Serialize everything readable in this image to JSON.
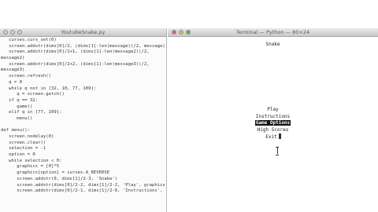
{
  "editor": {
    "title": "YoutubeSnake.py",
    "lines": [
      "   curses.curs_set(0)",
      "   screen.addstr(dims[0]/2, (dims[1]-len(message))/2, message)",
      "   screen.addstr(dims[0]/2+1, (dims[1]-len(message2))/2,",
      "message2)",
      "   screen.addstr(dims[0]/2+2, (dims[1]-len(message3))/2,",
      "message3)",
      "   screen.refresh()",
      "   q = 0",
      "   while q not in [32, 10, 77, 109]:",
      "      q = screen.getch()",
      "   if q == 32:",
      "      game()",
      "   elif q in [77, 109]:",
      "      menu()",
      "",
      "def menu():",
      "   screen.nodelay(0)",
      "   screen.clear()",
      "   selection = -1",
      "   option = 0",
      "   while selection < 0:",
      "      graphics = [0]*5",
      "      graphics[option] = curses.A_REVERSE",
      "      screen.addstr(0, dims[1]/2-3, 'Snake')",
      "      screen.addstr(dims[0]/2-2, dims[1]/2-2, 'Play', graphics[0])",
      "      screen.addstr(dims[0]/2-1, dims[1]/2-6, 'Instructions',"
    ]
  },
  "terminal": {
    "title": "Terminal — Python — 80×24",
    "game_title": "Snake",
    "menu_items": [
      {
        "label": "Play",
        "selected": false
      },
      {
        "label": "Instructions",
        "selected": false
      },
      {
        "label": "Game Options",
        "selected": true
      },
      {
        "label": "High Scores",
        "selected": false
      },
      {
        "label": "Exit",
        "selected": false
      }
    ]
  }
}
